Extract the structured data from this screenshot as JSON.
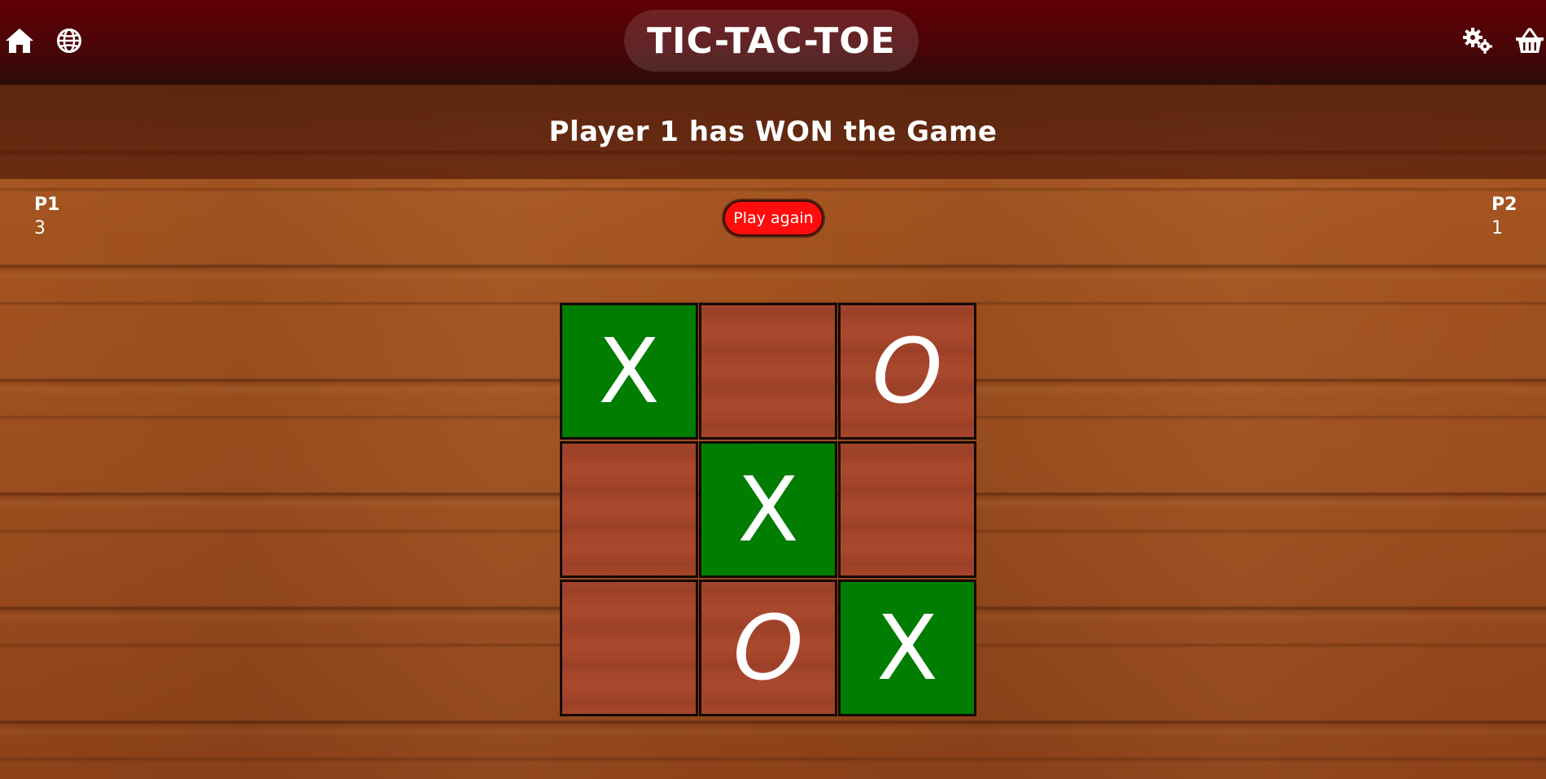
{
  "header": {
    "title": "TIC-TAC-TOE",
    "icons": {
      "home": "home-icon",
      "language": "globe-icon",
      "settings": "gears-icon",
      "shop": "basket-icon"
    }
  },
  "status": {
    "message": "Player 1 has WON the Game"
  },
  "scores": {
    "p1": {
      "label": "P1",
      "value": "3"
    },
    "p2": {
      "label": "P2",
      "value": "1"
    }
  },
  "actions": {
    "play_again": "Play again"
  },
  "board": {
    "cells": [
      {
        "mark": "X",
        "winning": true
      },
      {
        "mark": "",
        "winning": false
      },
      {
        "mark": "O",
        "winning": false
      },
      {
        "mark": "",
        "winning": false
      },
      {
        "mark": "X",
        "winning": true
      },
      {
        "mark": "",
        "winning": false
      },
      {
        "mark": "",
        "winning": false
      },
      {
        "mark": "O",
        "winning": false
      },
      {
        "mark": "X",
        "winning": true
      }
    ]
  },
  "colors": {
    "header_bg": "#5f0003",
    "win_cell": "#017d01",
    "cell": "#a4442a",
    "play_again_button": "#ff0d0d"
  }
}
